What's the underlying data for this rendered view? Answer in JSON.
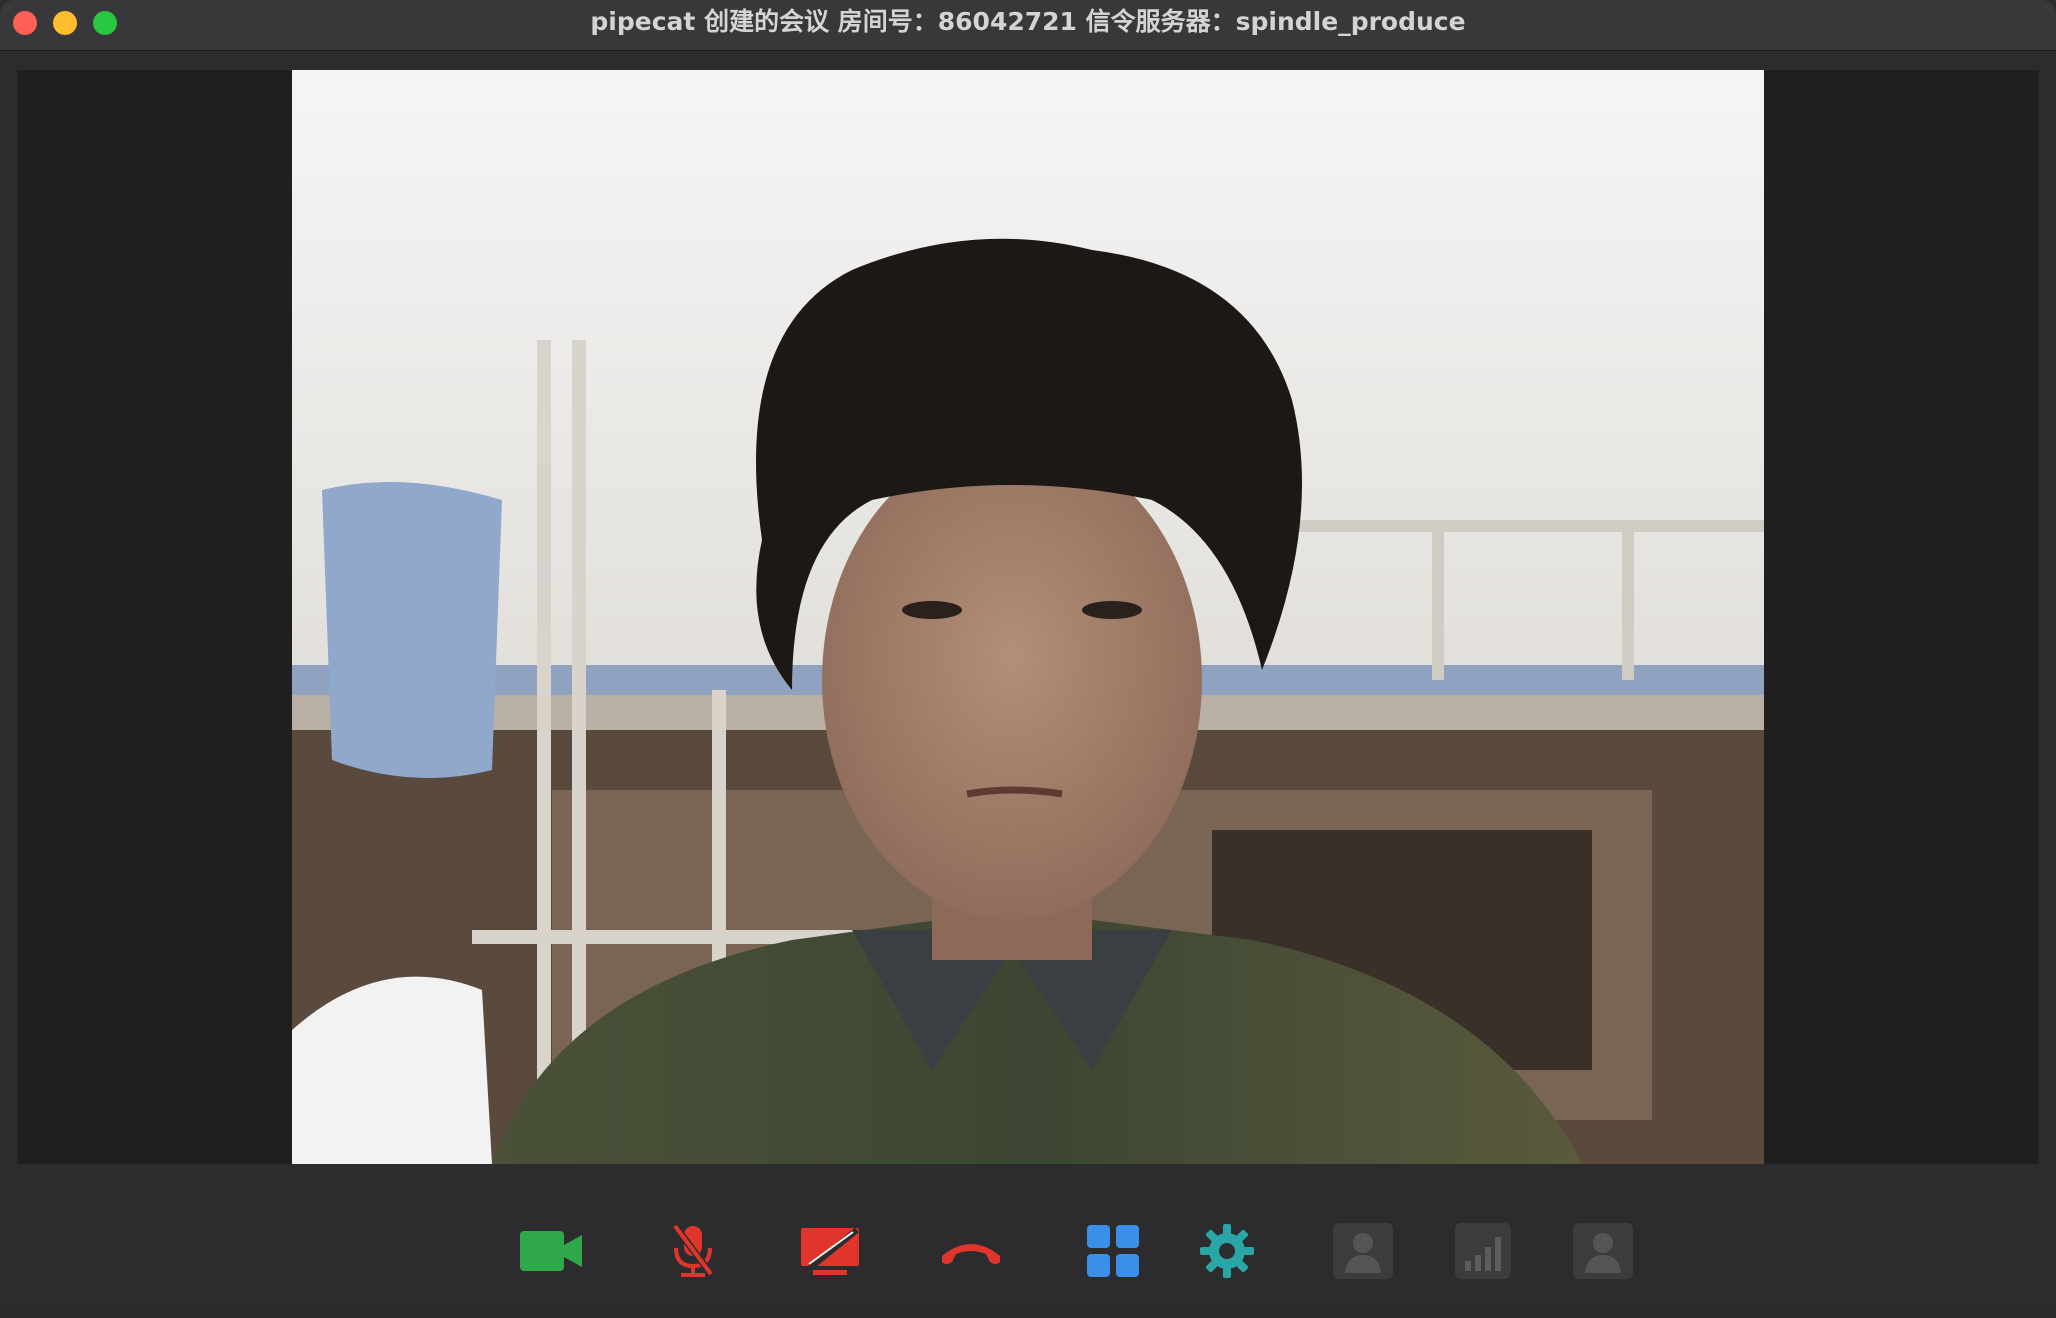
{
  "window": {
    "title": "pipecat 创建的会议  房间号：86042721  信令服务器：spindle_produce"
  },
  "colors": {
    "camera": "#2fa84a",
    "mic_muted": "#e0352b",
    "screen_share_off": "#e0352b",
    "hangup": "#e0352b",
    "layout": "#3a8fe8",
    "settings": "#2aa6a6",
    "disabled": "#4a4a4c"
  },
  "toolbar": {
    "items": [
      {
        "id": "camera",
        "icon": "video-camera-icon",
        "state": "on"
      },
      {
        "id": "mic",
        "icon": "microphone-muted-icon",
        "state": "muted"
      },
      {
        "id": "screen",
        "icon": "screen-share-off-icon",
        "state": "off"
      },
      {
        "id": "hangup",
        "icon": "phone-hangup-icon",
        "state": "active"
      },
      {
        "id": "layout",
        "icon": "grid-layout-icon",
        "state": "active"
      },
      {
        "id": "settings",
        "icon": "gear-icon",
        "state": "active"
      },
      {
        "id": "participants",
        "icon": "participants-icon",
        "state": "disabled"
      },
      {
        "id": "network",
        "icon": "signal-bars-icon",
        "state": "disabled"
      },
      {
        "id": "profile",
        "icon": "user-profile-icon",
        "state": "disabled"
      }
    ]
  }
}
